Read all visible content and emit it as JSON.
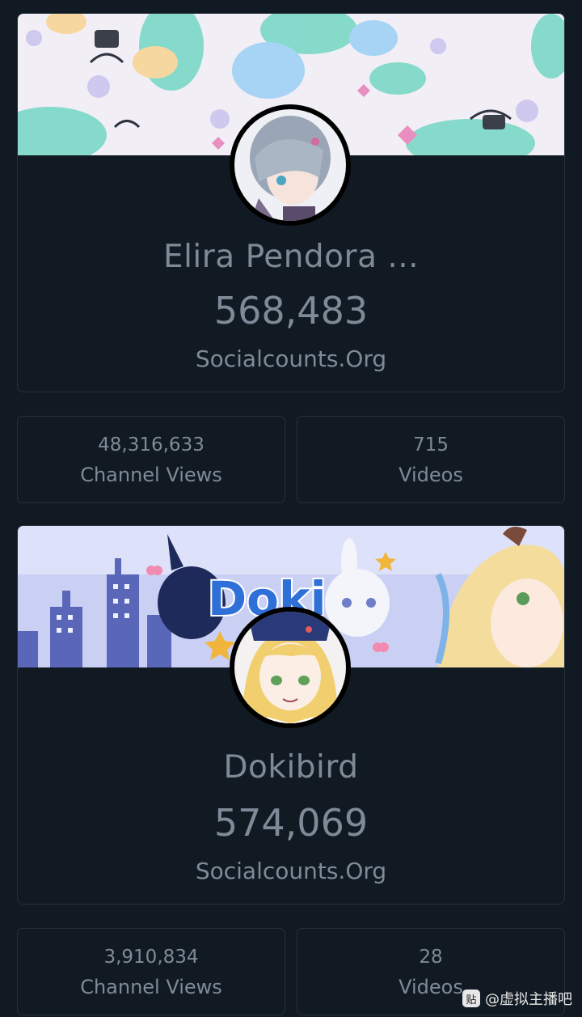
{
  "channels": [
    {
      "name": "Elira Pendora ...",
      "subscribers": "568,483",
      "source": "Socialcounts.Org",
      "stats": [
        {
          "value": "48,316,633",
          "label": "Channel Views"
        },
        {
          "value": "715",
          "label": "Videos"
        }
      ]
    },
    {
      "name": "Dokibird",
      "subscribers": "574,069",
      "source": "Socialcounts.Org",
      "stats": [
        {
          "value": "3,910,834",
          "label": "Channel Views"
        },
        {
          "value": "28",
          "label": "Videos"
        }
      ]
    }
  ],
  "banner2_text": "Doki",
  "watermark": {
    "icon_text": "贴",
    "text": "@虚拟主播吧"
  },
  "colors": {
    "background": "#111a22",
    "card_border": "#25303a",
    "text": "#7e8a97"
  }
}
